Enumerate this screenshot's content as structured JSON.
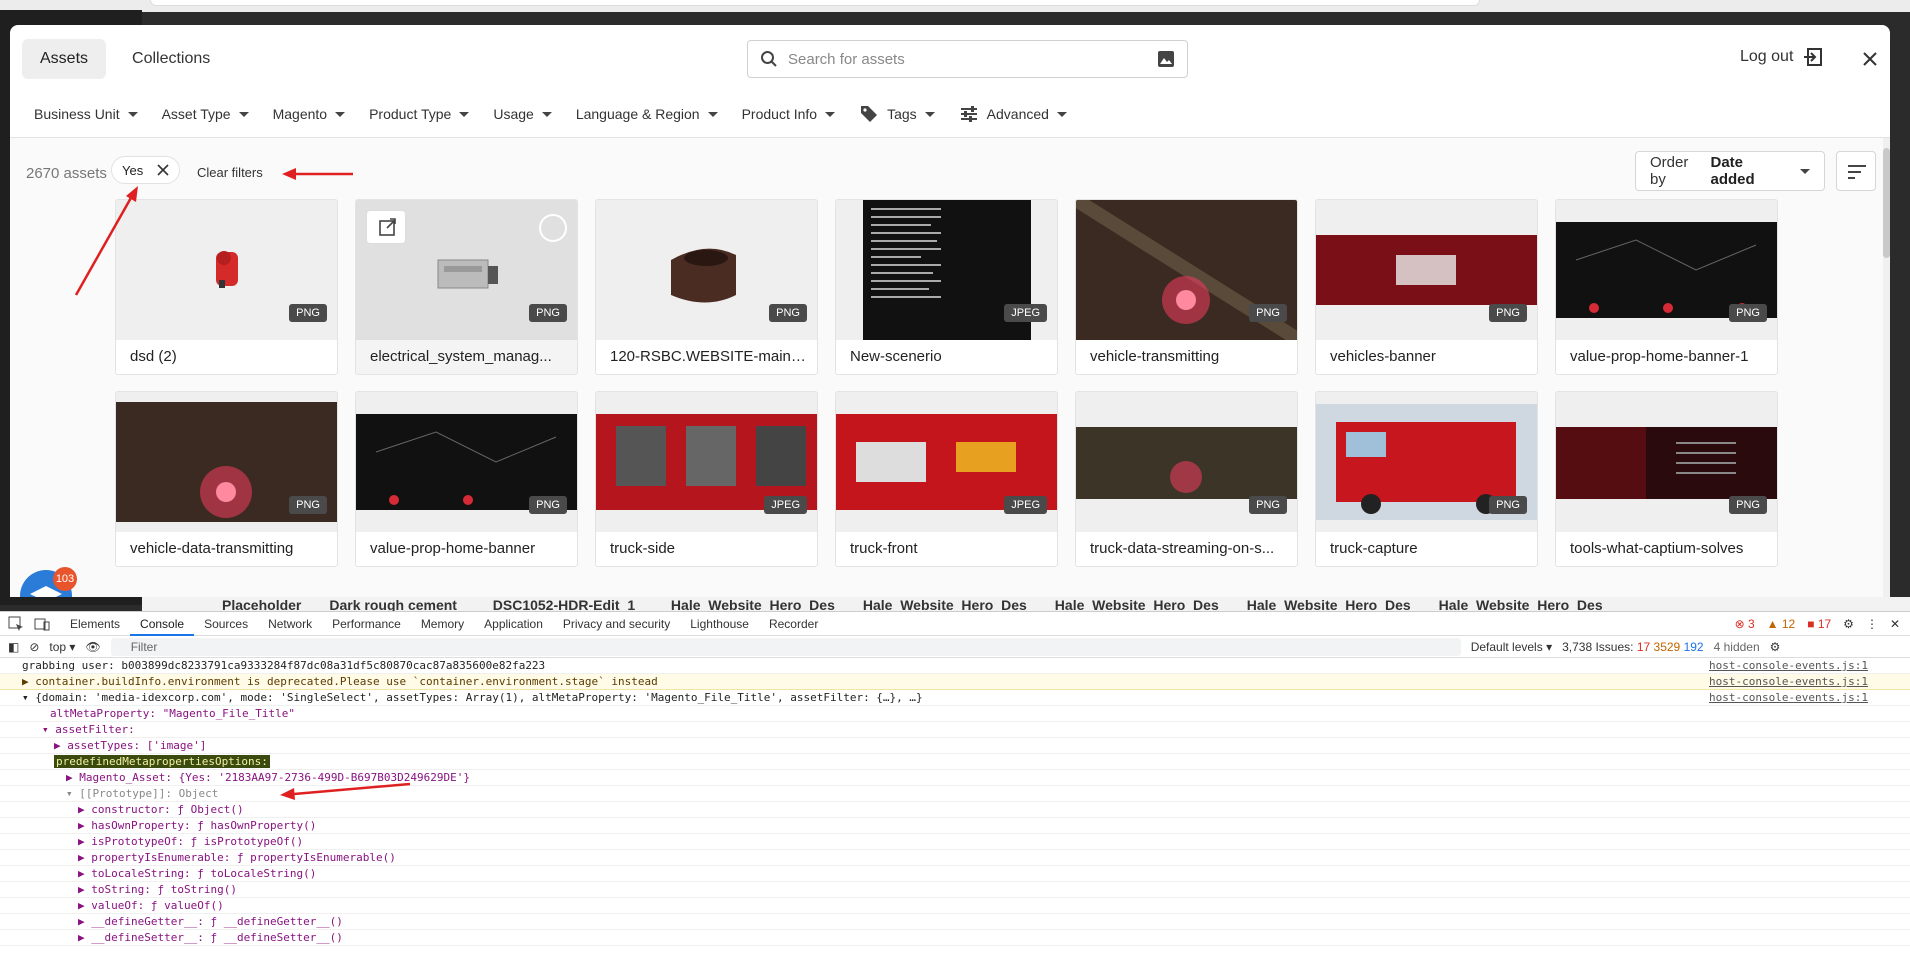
{
  "modal": {
    "tabs": [
      "Assets",
      "Collections"
    ],
    "search_placeholder": "Search for assets",
    "logout": "Log out",
    "filters": [
      "Business Unit",
      "Asset Type",
      "Magento",
      "Product Type",
      "Usage",
      "Language & Region",
      "Product Info",
      "Tags",
      "Advanced"
    ],
    "asset_count": "2670 assets",
    "chip": "Yes",
    "clear_filters": "Clear filters",
    "order_prefix": "Order by",
    "order_value": "Date added"
  },
  "cards": [
    {
      "title": "dsd (2)",
      "type": "PNG"
    },
    {
      "title": "electrical_system_manag...",
      "type": "PNG"
    },
    {
      "title": "120-RSBC.WEBSITE-main-...",
      "type": "PNG"
    },
    {
      "title": "New-scenerio",
      "type": "JPEG"
    },
    {
      "title": "vehicle-transmitting",
      "type": "PNG"
    },
    {
      "title": "vehicles-banner",
      "type": "PNG"
    },
    {
      "title": "value-prop-home-banner-1",
      "type": "PNG"
    },
    {
      "title": "vehicle-data-transmitting",
      "type": "PNG"
    },
    {
      "title": "value-prop-home-banner",
      "type": "PNG"
    },
    {
      "title": "truck-side",
      "type": "JPEG"
    },
    {
      "title": "truck-front",
      "type": "JPEG"
    },
    {
      "title": "truck-data-streaming-on-s...",
      "type": "PNG"
    },
    {
      "title": "truck-capture",
      "type": "PNG"
    },
    {
      "title": "tools-what-captium-solves",
      "type": "PNG"
    }
  ],
  "help_badge": "103",
  "under_strip": [
    "Placeholder",
    "Dark rough cement",
    "_DSC1052-HDR-Edit_1_",
    "Hale_Website_Hero_Des",
    "Hale_Website_Hero_Des",
    "Hale_Website_Hero_Des",
    "Hale_Website_Hero_Des",
    "Hale_Website_Hero_Des"
  ],
  "devtools": {
    "tabs": [
      "Elements",
      "Console",
      "Sources",
      "Network",
      "Performance",
      "Memory",
      "Application",
      "Privacy and security",
      "Lighthouse",
      "Recorder"
    ],
    "errors": "3",
    "warnings": "12",
    "infos": "17",
    "context": "top",
    "filter_placeholder": "Filter",
    "levels": "Default levels",
    "issues": "3,738 Issues:",
    "issue_counts": [
      "17",
      "3529",
      "192"
    ],
    "hidden": "4 hidden",
    "lines": [
      {
        "text": "grabbing user:  b003899dc8233791ca9333284f87dc08a31df5c80870cac87a835600e82fa223",
        "src": "host-console-events.js:1"
      },
      {
        "text": "▶ container.buildInfo.environment is deprecated.Please use `container.environment.stage` instead",
        "src": "host-console-events.js:1"
      },
      {
        "text": "▾ {domain: 'media-idexcorp.com', mode: 'SingleSelect', assetTypes: Array(1), altMetaProperty: 'Magento_File_Title', assetFilter: {…}, …}",
        "src": "host-console-events.js:1"
      },
      {
        "text": "altMetaProperty: \"Magento_File_Title\""
      },
      {
        "text": "▾ assetFilter:"
      },
      {
        "text": "▶ assetTypes: ['image']"
      },
      {
        "text": "predefinedMetapropertiesOptions:"
      },
      {
        "text": "▶ Magento_Asset: {Yes: '2183AA97-2736-499D-B697B03D249629DE'}"
      },
      {
        "text": "▾ [[Prototype]]: Object"
      },
      {
        "text": "▶ constructor: ƒ Object()"
      },
      {
        "text": "▶ hasOwnProperty: ƒ hasOwnProperty()"
      },
      {
        "text": "▶ isPrototypeOf: ƒ isPrototypeOf()"
      },
      {
        "text": "▶ propertyIsEnumerable: ƒ propertyIsEnumerable()"
      },
      {
        "text": "▶ toLocaleString: ƒ toLocaleString()"
      },
      {
        "text": "▶ toString: ƒ toString()"
      },
      {
        "text": "▶ valueOf: ƒ valueOf()"
      },
      {
        "text": "▶ __defineGetter__: ƒ __defineGetter__()"
      },
      {
        "text": "▶ __defineSetter__: ƒ __defineSetter__()"
      }
    ]
  }
}
